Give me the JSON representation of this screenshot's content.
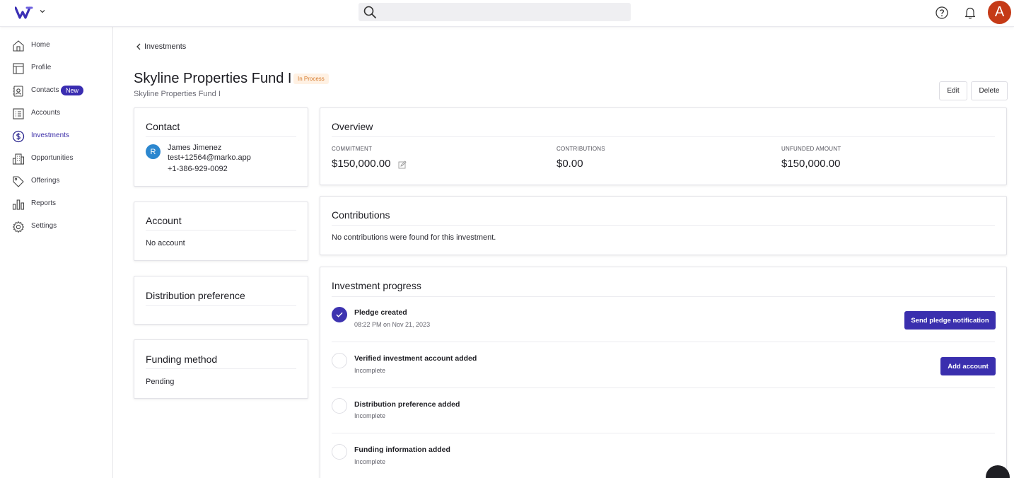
{
  "header": {
    "search_placeholder": "",
    "user_initial": "A"
  },
  "sidebar": {
    "items": [
      {
        "label": "Home",
        "icon": "home-icon"
      },
      {
        "label": "Profile",
        "icon": "profile-icon"
      },
      {
        "label": "Contacts",
        "icon": "contacts-icon",
        "badge": "New"
      },
      {
        "label": "Accounts",
        "icon": "accounts-icon"
      },
      {
        "label": "Investments",
        "icon": "dollar-icon",
        "active": true
      },
      {
        "label": "Opportunities",
        "icon": "building-icon"
      },
      {
        "label": "Offerings",
        "icon": "tag-icon"
      },
      {
        "label": "Reports",
        "icon": "bar-chart-icon"
      },
      {
        "label": "Settings",
        "icon": "gear-icon"
      }
    ]
  },
  "page": {
    "back_label": "Investments",
    "title": "Skyline Properties Fund I",
    "status": "In Process",
    "subtitle": "Skyline Properties Fund I",
    "edit_label": "Edit",
    "delete_label": "Delete"
  },
  "contact": {
    "title": "Contact",
    "initial": "R",
    "name": "James Jimenez",
    "email": "test+12564@marko.app",
    "phone": "+1-386-929-0092"
  },
  "account": {
    "title": "Account",
    "value": "No account"
  },
  "distribution": {
    "title": "Distribution preference"
  },
  "funding": {
    "title": "Funding method",
    "value": "Pending"
  },
  "overview": {
    "title": "Overview",
    "commitment_label": "COMMITMENT",
    "commitment_value": "$150,000.00",
    "contributions_label": "CONTRIBUTIONS",
    "contributions_value": "$0.00",
    "unfunded_label": "UNFUNDED AMOUNT",
    "unfunded_value": "$150,000.00"
  },
  "contributions": {
    "title": "Contributions",
    "empty_text": "No contributions were found for this investment."
  },
  "progress": {
    "title": "Investment progress",
    "steps": [
      {
        "title": "Pledge created",
        "sub": "08:22 PM on Nov 21, 2023",
        "done": true,
        "action": "Send pledge notification"
      },
      {
        "title": "Verified investment account added",
        "sub": "Incomplete",
        "done": false,
        "action": "Add account"
      },
      {
        "title": "Distribution preference added",
        "sub": "Incomplete",
        "done": false
      },
      {
        "title": "Funding information added",
        "sub": "Incomplete",
        "done": false
      }
    ]
  },
  "colors": {
    "accent": "#3a2fae",
    "status_bg": "#fff1e3",
    "status_text": "#d57a2c",
    "avatar_top": "#c53a17",
    "contact_avatar": "#2c87cf"
  }
}
